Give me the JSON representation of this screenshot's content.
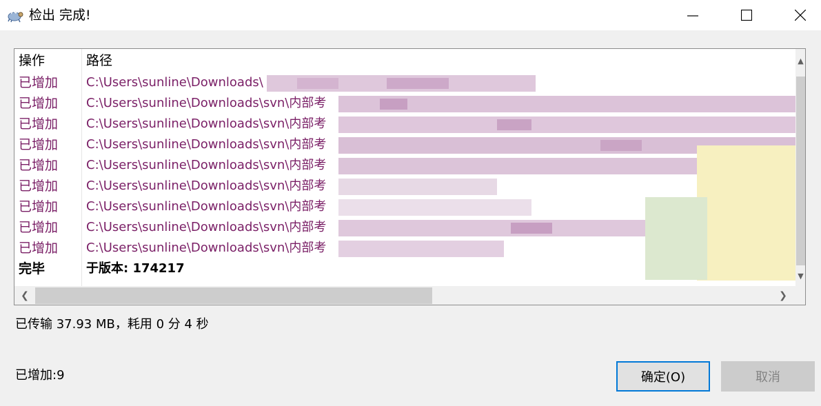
{
  "window": {
    "title": "检出 完成!",
    "icon": "tortoisesvn-icon"
  },
  "list": {
    "headers": {
      "action": "操作",
      "path": "路径"
    },
    "rows": [
      {
        "action": "已增加",
        "path": "C:\\Users\\sunline\\Downloads\\"
      },
      {
        "action": "已增加",
        "path": "C:\\Users\\sunline\\Downloads\\svn\\内部考"
      },
      {
        "action": "已增加",
        "path": "C:\\Users\\sunline\\Downloads\\svn\\内部考"
      },
      {
        "action": "已增加",
        "path": "C:\\Users\\sunline\\Downloads\\svn\\内部考"
      },
      {
        "action": "已增加",
        "path": "C:\\Users\\sunline\\Downloads\\svn\\内部考"
      },
      {
        "action": "已增加",
        "path": "C:\\Users\\sunline\\Downloads\\svn\\内部考"
      },
      {
        "action": "已增加",
        "path": "C:\\Users\\sunline\\Downloads\\svn\\内部考"
      },
      {
        "action": "已增加",
        "path": "C:\\Users\\sunline\\Downloads\\svn\\内部考"
      },
      {
        "action": "已增加",
        "path": "C:\\Users\\sunline\\Downloads\\svn\\内部考"
      },
      {
        "action": "完毕",
        "path": "于版本: 174217"
      }
    ]
  },
  "status": {
    "transfer": "已传输 37.93 MB，耗用 0 分 4 秒",
    "added": "已增加:9"
  },
  "buttons": {
    "ok": "确定(O)",
    "cancel": "取消"
  },
  "colors": {
    "added_text": "#7a1f66",
    "ok_border": "#0078d7"
  }
}
